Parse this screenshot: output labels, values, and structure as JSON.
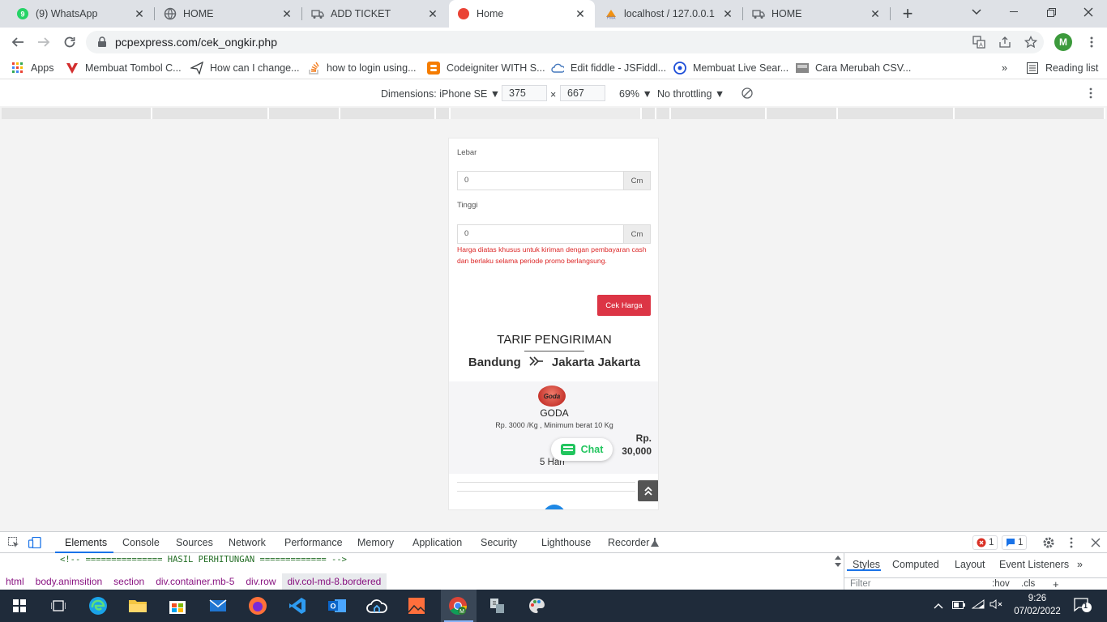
{
  "tabs": [
    {
      "title": "(9) WhatsApp",
      "icon": "whatsapp-icon"
    },
    {
      "title": "HOME",
      "icon": "globe-icon"
    },
    {
      "title": "ADD TICKET",
      "icon": "truck-icon"
    },
    {
      "title": "Home",
      "icon": "red-dot-icon",
      "active": true
    },
    {
      "title": "localhost / 127.0.0.1 /",
      "icon": "phpmyadmin-icon"
    },
    {
      "title": "HOME",
      "icon": "truck-icon"
    }
  ],
  "address": {
    "url": "pcpexpress.com/cek_ongkir.php",
    "avatar_letter": "M"
  },
  "bookmarks": {
    "apps": "Apps",
    "items": [
      "Membuat Tombol C...",
      "How can I change...",
      "how to login using...",
      "Codeigniter WITH S...",
      "Edit fiddle - JSFiddl...",
      "Membuat Live Sear...",
      "Cara Merubah CSV..."
    ],
    "more": "»",
    "reading_list": "Reading list"
  },
  "device_toolbar": {
    "dimensions_label": "Dimensions: iPhone SE ▼",
    "width": "375",
    "times": "×",
    "height": "667",
    "zoom": "69% ▼",
    "throttle": "No throttling ▼"
  },
  "form": {
    "lebar_label": "Lebar",
    "lebar_value": "0",
    "tinggi_label": "Tinggi",
    "tinggi_value": "0",
    "unit": "Cm",
    "note": "Harga diatas khusus untuk kiriman dengan pembayaran cash dan berlaku selama periode promo berlangsung.",
    "button": "Cek Harga"
  },
  "tarif": {
    "title": "TARIF PENGIRIMAN",
    "origin": "Bandung",
    "destination": "Jakarta Jakarta"
  },
  "courier": {
    "logo_text": "Goda",
    "name": "GODA",
    "rate": "Rp. 3000 /Kg , Minimum berat 10 Kg",
    "price_currency": "Rp.",
    "price_value": "30,000",
    "eta": "5 Hari"
  },
  "chat_label": "Chat",
  "devtools": {
    "tabs": [
      "Elements",
      "Console",
      "Sources",
      "Network",
      "Performance",
      "Memory",
      "Application",
      "Security",
      "Lighthouse",
      "Recorder"
    ],
    "errors": "1",
    "messages": "1",
    "comment": "<!-- =============== HASIL PERHITUNGAN ============= -->",
    "breadcrumbs": [
      "html",
      "body.animsition",
      "section",
      "div.container.mb-5",
      "div.row",
      "div.col-md-8.bordered"
    ],
    "side_tabs": [
      "Styles",
      "Computed",
      "Layout",
      "Event Listeners"
    ],
    "side_more": "»",
    "filter_placeholder": "Filter",
    "hov": ":hov",
    "cls": ".cls"
  },
  "taskbar": {
    "time": "9:26",
    "date": "07/02/2022",
    "notifications": "1"
  }
}
